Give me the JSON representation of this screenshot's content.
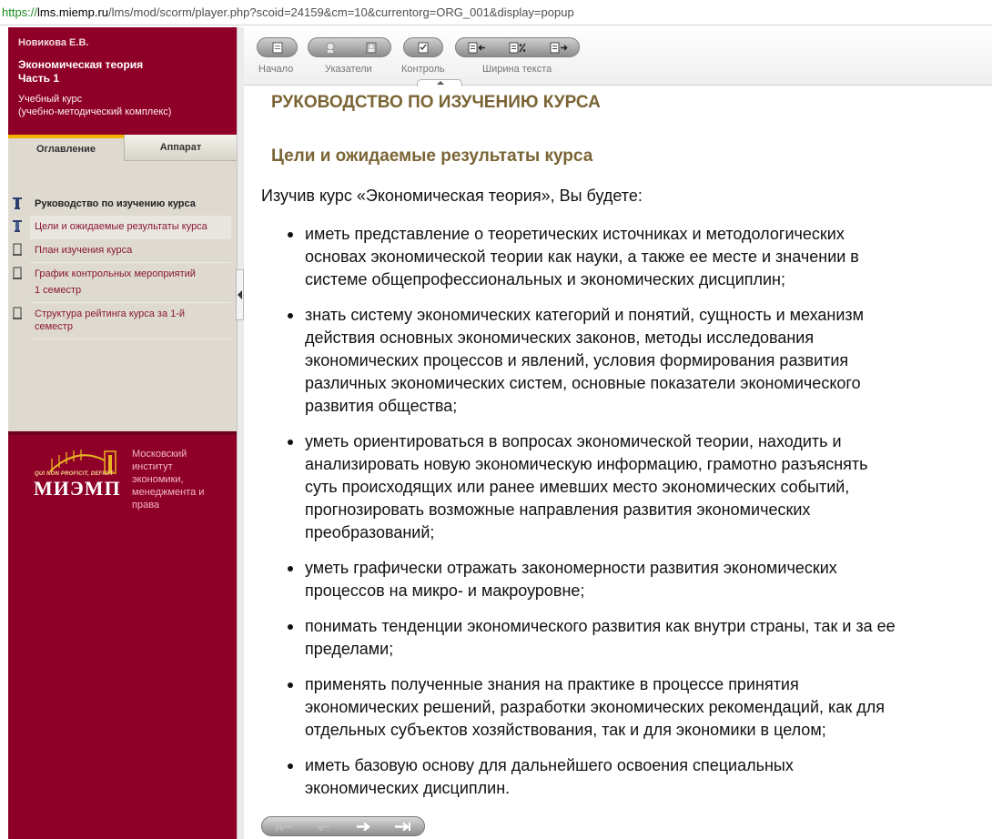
{
  "address_bar": {
    "scheme": "https://",
    "host": "lms.miemp.ru",
    "path": "/lms/mod/scorm/player.php?scoid=24159&cm=10&currentorg=ORG_001&display=popup"
  },
  "sidebar": {
    "author": "Новикова Е.В.",
    "course_title": "Экономическая теория",
    "course_part": "Часть 1",
    "course_kind": "Учебный курс",
    "course_kind_detail": "(учебно-методический комплекс)",
    "tabs": [
      {
        "label": "Оглавление",
        "active": true
      },
      {
        "label": "Аппарат",
        "active": false
      }
    ],
    "toc": [
      {
        "label": "Руководство по изучению курса",
        "style": "bold"
      },
      {
        "label": "Цели и ожидаемые результаты курса",
        "style": "selected"
      },
      {
        "label": "План изучения курса",
        "style": "normal"
      },
      {
        "label": "График контрольных мероприятий",
        "sub": "1 семестр",
        "style": "normal"
      },
      {
        "label": "Структура рейтинга курса за 1-й",
        "sub": "семестр",
        "style": "normal"
      }
    ],
    "logo": {
      "motto": "QUI NON PROFICIT, DEFICIT",
      "name": "МИЭМП",
      "institute_lines": [
        "Московский",
        "институт",
        "экономики,",
        "менеджмента и",
        "права"
      ]
    }
  },
  "toolbar": {
    "home_label": "Начало",
    "indexes_label": "Указатели",
    "control_label": "Контроль",
    "text_width_label": "Ширина текста"
  },
  "content": {
    "heading": "РУКОВОДСТВО ПО ИЗУЧЕНИЮ КУРСА",
    "subheading": "Цели и ожидаемые результаты курса",
    "intro": "Изучив курс «Экономическая теория», Вы будете:",
    "goals": [
      {
        "line1": "иметь представление о теоретических источниках и методологических",
        "line2": "основах экономической теории как науки, а также ее месте и значении в",
        "line3": "системе общепрофессиональных и экономических дисциплин;"
      },
      {
        "line1": "знать систему экономических категорий и понятий, сущность и механизм",
        "line2": "действия основных экономических законов, методы исследования",
        "line3": "экономических процессов и явлений, условия формирования развития",
        "line4": "различных экономических систем, основные показатели экономического",
        "line5": "развития общества;"
      },
      {
        "line1": "уметь ориентироваться в вопросах экономической теории, находить и",
        "line2": "анализировать новую экономическую информацию, грамотно разъяснять",
        "line3": "суть происходящих или ранее имевших место экономических событий,",
        "line4": "прогнозировать возможные направления развития экономических",
        "line5": "преобразований;"
      },
      {
        "line1": "уметь графически отражать закономерности развития экономических",
        "line2": "процессов на микро- и макроуровне;"
      },
      {
        "line1": "понимать тенденции экономического развития как внутри страны, так и за ее",
        "line2": "пределами;"
      },
      {
        "line1": "применять полученные знания на практике в процессе принятия",
        "line2": "экономических решений, разработки экономических рекомендаций, как для",
        "line3": "отдельных субъектов хозяйствования, так и для экономики в целом;"
      },
      {
        "line1": "иметь базовую основу для дальнейшего освоения специальных",
        "line2": "экономических дисциплин."
      }
    ]
  },
  "colors": {
    "sidebar_bg": "#8f0028",
    "toc_bg": "#dedad0",
    "heading": "#7a6434",
    "tab_accent": "#f2b000"
  },
  "icons": {
    "toc": "document-pin-icon",
    "home": "home-icon",
    "indexes": "index-icon",
    "control": "checklist-icon",
    "text_width": "text-width-icon",
    "nav": [
      "first-icon",
      "prev-icon",
      "next-icon",
      "last-icon"
    ]
  }
}
